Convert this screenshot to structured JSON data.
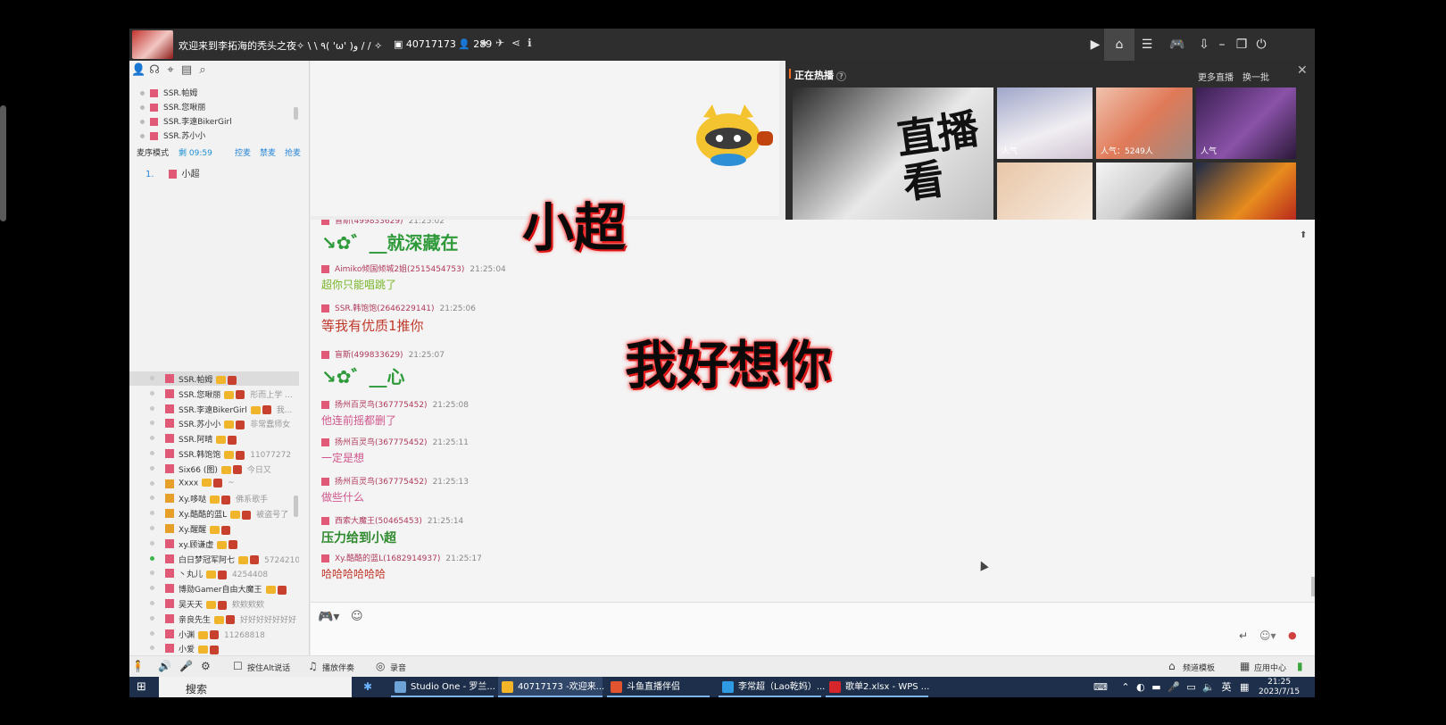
{
  "titlebar": {
    "room_title": "欢迎来到李拓海的秃头之夜✧ \\ \\ ٩( 'ω' )و / / ✧",
    "room_id": "40717173",
    "user_count": "289"
  },
  "left_panel": {
    "seats": [
      "SSR.帕姆",
      "SSR.您啾丽",
      "SSR.李遠BikerGirl",
      "SSR.苏小小"
    ],
    "queue": {
      "mode": "麦序模式",
      "timer": "剩 09:59",
      "actions": [
        "控麦",
        "禁麦",
        "抢麦"
      ],
      "first": {
        "num": "1.",
        "name": "小超"
      }
    },
    "members": [
      {
        "name": "SSR.帕姆",
        "sig": ""
      },
      {
        "name": "SSR.您啾丽",
        "sig": "形而上学 ..."
      },
      {
        "name": "SSR.李遠BikerGirl",
        "sig": "我..."
      },
      {
        "name": "SSR.苏小小",
        "sig": "非常蠢师女"
      },
      {
        "name": "SSR.阿晴",
        "sig": ""
      },
      {
        "name": "SSR.韩饱饱",
        "sig": "11077272"
      },
      {
        "name": "Six66 (图)",
        "sig": "今日又"
      },
      {
        "name": "Xxxx",
        "sig": "~"
      },
      {
        "name": "Xy.哆哒",
        "sig": "佛系歌手"
      },
      {
        "name": "Xy.酷酷的蓝L",
        "sig": "被盗号了"
      },
      {
        "name": "Xy.醒醒",
        "sig": ""
      },
      {
        "name": "xy.顾谦虚",
        "sig": ""
      },
      {
        "name": "白日梦冠军阿七",
        "sig": "5724210"
      },
      {
        "name": "丶丸儿",
        "sig": "4254408"
      },
      {
        "name": "博勋Gamer自由大魔王",
        "sig": ""
      },
      {
        "name": "吴天天",
        "sig": "欸欸欸欸"
      },
      {
        "name": "亲良先生",
        "sig": "好好好好好好好"
      },
      {
        "name": "小渊",
        "sig": "11268818"
      },
      {
        "name": "小爱",
        "sig": ""
      }
    ]
  },
  "hot": {
    "title": "正在热播",
    "more": "更多直播",
    "refresh": "换一批",
    "main_text": "直播看",
    "pops": [
      "人气",
      "人气：5249人",
      "人气"
    ],
    "close": "✕"
  },
  "chat": {
    "messages": [
      {
        "user": "盲斯(499833629)",
        "time": "21:25:02",
        "text": "↘✿゛__就深藏在",
        "color": "#2f9a3a",
        "size": "20px",
        "bold": true
      },
      {
        "user": "Aimiko倾国倾城2姐(2515454753)",
        "time": "21:25:04",
        "text": "超你只能唱跳了",
        "color": "#78b62a",
        "size": "12px",
        "bold": false
      },
      {
        "user": "SSR.韩饱饱(2646229141)",
        "time": "21:25:06",
        "text": "等我有优质1推你",
        "color": "#c0392b",
        "size": "15px",
        "bold": false
      },
      {
        "user": "盲斯(499833629)",
        "time": "21:25:07",
        "text": "↘✿゛__心",
        "color": "#2f9a3a",
        "size": "20px",
        "bold": true
      },
      {
        "user": "扬州百灵鸟(367775452)",
        "time": "21:25:08",
        "text": "他连前摇都删了",
        "color": "#d0568c",
        "size": "12px",
        "bold": false
      },
      {
        "user": "扬州百灵鸟(367775452)",
        "time": "21:25:11",
        "text": "一定是想",
        "color": "#d0568c",
        "size": "12px",
        "bold": false
      },
      {
        "user": "扬州百灵鸟(367775452)",
        "time": "21:25:13",
        "text": "做些什么",
        "color": "#d0568c",
        "size": "12px",
        "bold": false
      },
      {
        "user": "西索大魔王(50465453)",
        "time": "21:25:14",
        "text": "压力给到小超",
        "color": "#2f8a2f",
        "size": "14px",
        "bold": true
      },
      {
        "user": "Xy.酷酷的蓝L(1682914937)",
        "time": "21:25:17",
        "text": "哈哈哈哈哈哈",
        "color": "#c0392b",
        "size": "12px",
        "bold": false
      }
    ],
    "danmaku": [
      "小超",
      "我好想你"
    ]
  },
  "bottombar": {
    "ptt": "按住Alt说话",
    "accompany": "播放伴奏",
    "record": "录音",
    "template": "频道模板",
    "right_text": "应用中心"
  },
  "taskbar": {
    "search": "搜索",
    "tasks": [
      "Studio One - 罗兰...",
      "40717173 -欢迎来...",
      "斗鱼直播伴侣",
      "李常超（Lao乾妈）...",
      "歌单2.xlsx - WPS ..."
    ],
    "lang": "英",
    "time": "21:25",
    "date": "2023/7/15"
  },
  "colors": {
    "titlebar": "#2e2e2e",
    "taskbar": "#1d2f4a",
    "accent": "#2b88d8"
  }
}
